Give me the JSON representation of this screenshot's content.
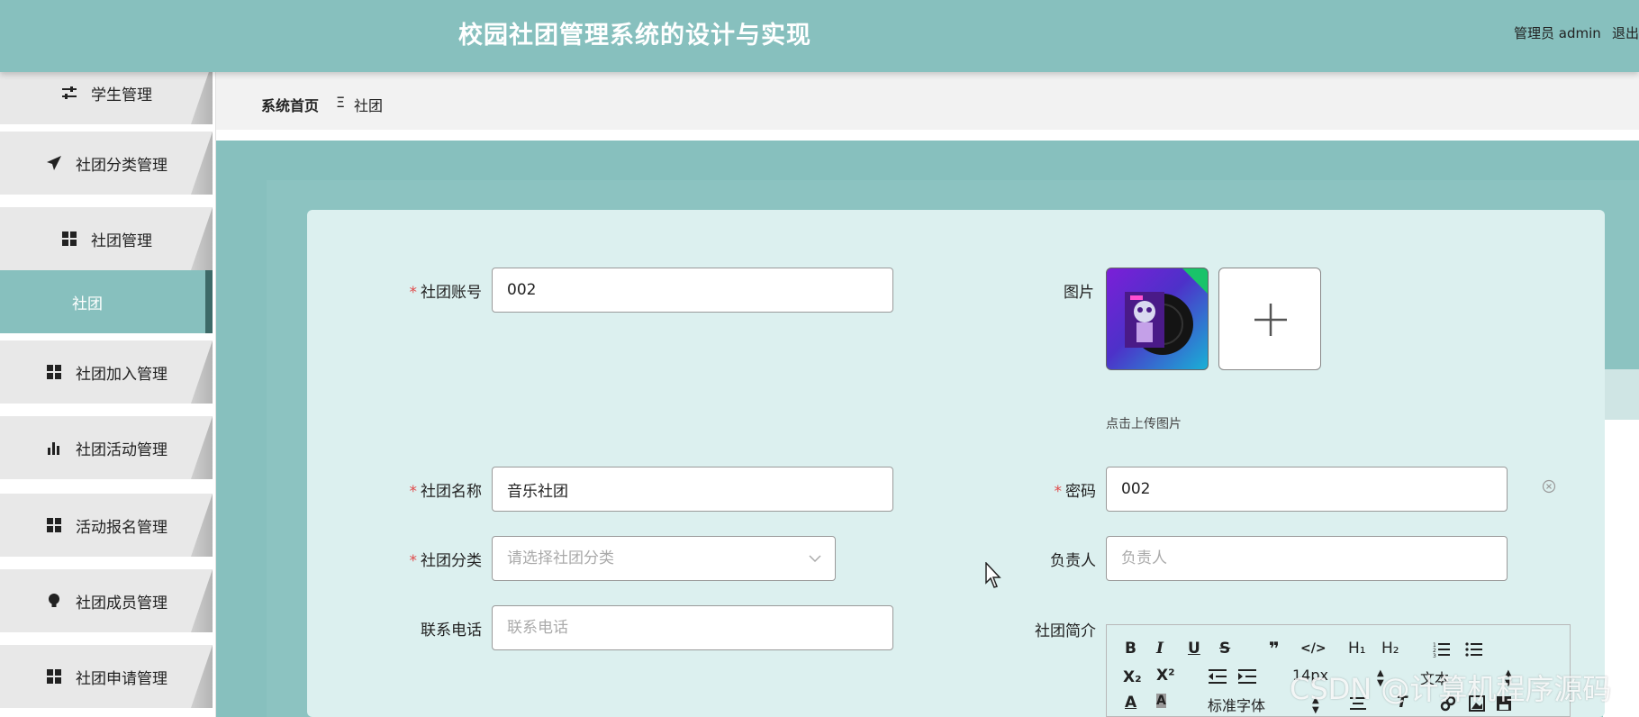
{
  "header": {
    "title": "校园社团管理系统的设计与实现",
    "user": "管理员 admin",
    "logout": "退出"
  },
  "sidebar": {
    "items": [
      {
        "label": "学生管理",
        "icon": "sliders-icon"
      },
      {
        "label": "社团分类管理",
        "icon": "paper-plane-icon"
      },
      {
        "label": "社团管理",
        "icon": "grid-icon"
      },
      {
        "label": "社团",
        "icon": "",
        "active": true
      },
      {
        "label": "社团加入管理",
        "icon": "grid-icon"
      },
      {
        "label": "社团活动管理",
        "icon": "bar-chart-icon"
      },
      {
        "label": "活动报名管理",
        "icon": "grid-icon"
      },
      {
        "label": "社团成员管理",
        "icon": "lightbulb-icon"
      },
      {
        "label": "社团申请管理",
        "icon": "grid-icon"
      }
    ]
  },
  "breadcrumb": {
    "home": "系统首页",
    "separator": "Ξ",
    "current": "社团"
  },
  "form": {
    "account": {
      "label": "社团账号",
      "required": "*",
      "value": "002"
    },
    "image": {
      "label": "图片",
      "tip": "点击上传图片"
    },
    "name": {
      "label": "社团名称",
      "required": "*",
      "value": "音乐社团"
    },
    "password": {
      "label": "密码",
      "required": "*",
      "value": "002"
    },
    "category": {
      "label": "社团分类",
      "required": "*",
      "placeholder": "请选择社团分类"
    },
    "leader": {
      "label": "负责人",
      "placeholder": "负责人"
    },
    "phone": {
      "label": "联系电话",
      "placeholder": "联系电话"
    },
    "intro": {
      "label": "社团简介"
    }
  },
  "editor": {
    "toolbar": {
      "bold": "B",
      "italic": "I",
      "underline": "U",
      "strike": "S",
      "quote": "❞",
      "code": "</>",
      "h1": "H₁",
      "h2": "H₂",
      "sub": "X₂",
      "sup": "X²",
      "font_size": "14px",
      "text_style": "文本",
      "font_family": "标准字体"
    }
  },
  "watermark": "CSDN @计算机程序源码",
  "colors": {
    "header": "#87c0be",
    "active_item": "#87c0be",
    "card": "#dcf0ef",
    "required": "#e04a4a"
  }
}
